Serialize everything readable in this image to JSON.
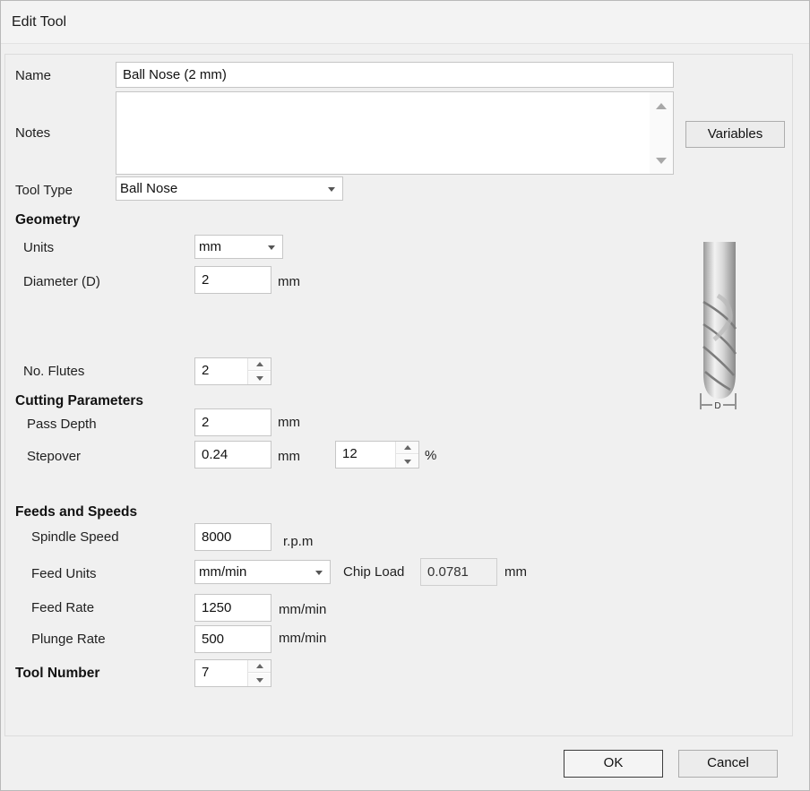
{
  "window": {
    "title": "Edit Tool"
  },
  "form": {
    "name_label": "Name",
    "name_value": "Ball Nose (2 mm)",
    "notes_label": "Notes",
    "notes_value": "",
    "variables_button": "Variables",
    "tool_type_label": "Tool Type",
    "tool_type_value": "Ball Nose"
  },
  "geometry": {
    "header": "Geometry",
    "units_label": "Units",
    "units_value": "mm",
    "diameter_label": "Diameter (D)",
    "diameter_value": "2",
    "diameter_unit": "mm",
    "flutes_label": "No. Flutes",
    "flutes_value": "2",
    "diagram_label": "D"
  },
  "cutting": {
    "header": "Cutting Parameters",
    "pass_depth_label": "Pass Depth",
    "pass_depth_value": "2",
    "pass_depth_unit": "mm",
    "stepover_label": "Stepover",
    "stepover_value": "0.24",
    "stepover_unit": "mm",
    "stepover_percent_value": "12",
    "stepover_percent_unit": "%"
  },
  "feeds": {
    "header": "Feeds and Speeds",
    "spindle_label": "Spindle Speed",
    "spindle_value": "8000",
    "spindle_unit": "r.p.m",
    "feed_units_label": "Feed Units",
    "feed_units_value": "mm/min",
    "chip_load_label": "Chip Load",
    "chip_load_value": "0.0781",
    "chip_load_unit": "mm",
    "feed_rate_label": "Feed Rate",
    "feed_rate_value": "1250",
    "feed_rate_unit": "mm/min",
    "plunge_rate_label": "Plunge Rate",
    "plunge_rate_value": "500",
    "plunge_rate_unit": "mm/min"
  },
  "tool_number": {
    "header": "Tool Number",
    "value": "7"
  },
  "footer": {
    "ok_button": "OK",
    "cancel_button": "Cancel"
  }
}
